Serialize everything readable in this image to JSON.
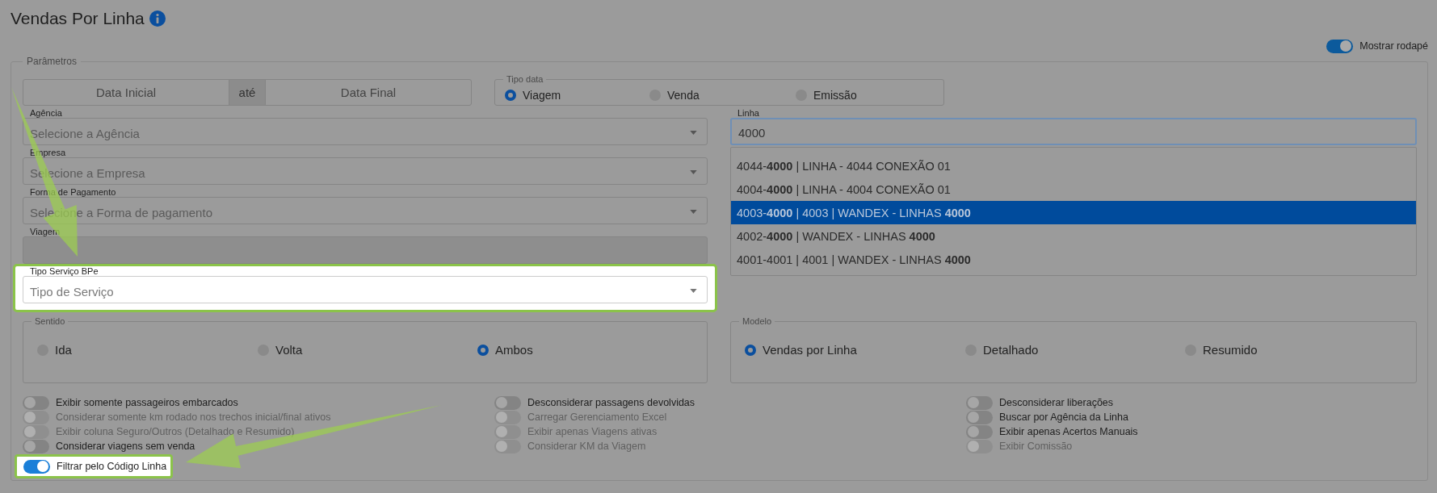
{
  "page": {
    "title": "Vendas Por Linha"
  },
  "footer_toggle": {
    "label": "Mostrar rodapé",
    "on": true
  },
  "parameters": {
    "legend": "Parâmetros",
    "date_range": {
      "start": "Data Inicial",
      "separator": "até",
      "end": "Data Final"
    },
    "date_type": {
      "legend": "Tipo data",
      "options": [
        {
          "label": "Viagem",
          "selected": true
        },
        {
          "label": "Venda",
          "selected": false
        },
        {
          "label": "Emissão",
          "selected": false
        }
      ]
    },
    "fields": [
      {
        "kind": "select",
        "label": "Agência",
        "placeholder": "Selecione a Agência",
        "disabled": false,
        "highlighted": false
      },
      {
        "kind": "select",
        "label": "Empresa",
        "placeholder": "Selecione a Empresa",
        "disabled": false,
        "highlighted": false
      },
      {
        "kind": "select",
        "label": "Forma de Pagamento",
        "placeholder": "Selecione a Forma de pagamento",
        "disabled": false,
        "highlighted": false
      },
      {
        "kind": "input",
        "label": "Viagem",
        "disabled": true,
        "highlighted": false
      },
      {
        "kind": "select",
        "label": "Tipo Serviço BPe",
        "placeholder": "Tipo de Serviço",
        "disabled": false,
        "highlighted": true
      }
    ],
    "linha": {
      "label": "Linha",
      "value": "4000",
      "suggestions": [
        {
          "text": "4044-**4000** | LINHA - 4044 CONEXÃO 01",
          "selected": false
        },
        {
          "text": "4004-**4000** | LINHA - 4004 CONEXÃO 01",
          "selected": false
        },
        {
          "text": "4003-**4000** | 4003 | WANDEX - LINHAS **4000**",
          "selected": true
        },
        {
          "text": "4002-**4000** | WANDEX - LINHAS **4000**",
          "selected": false
        },
        {
          "text": "4001-4001 | 4001 | WANDEX - LINHAS **4000**",
          "selected": false
        }
      ]
    },
    "direction": {
      "legend": "Sentido",
      "options": [
        {
          "label": "Ida",
          "selected": false
        },
        {
          "label": "Volta",
          "selected": false
        },
        {
          "label": "Ambos",
          "selected": true
        }
      ]
    },
    "model": {
      "legend": "Modelo",
      "options": [
        {
          "label": "Vendas por Linha",
          "selected": true
        },
        {
          "label": "Detalhado",
          "selected": false
        },
        {
          "label": "Resumido",
          "selected": false
        }
      ]
    },
    "option_columns": [
      {
        "items": [
          {
            "label": "Exibir somente passageiros embarcados",
            "on": false,
            "disabled": false,
            "highlighted": false
          },
          {
            "label": "Considerar somente km rodado nos trechos inicial/final ativos",
            "on": false,
            "disabled": true,
            "highlighted": false
          },
          {
            "label": "Exibir coluna Seguro/Outros (Detalhado e Resumido)",
            "on": false,
            "disabled": true,
            "highlighted": false
          },
          {
            "label": "Considerar viagens sem venda",
            "on": false,
            "disabled": false,
            "highlighted": false
          },
          {
            "label": "Filtrar pelo Código Linha",
            "on": true,
            "disabled": false,
            "highlighted": true
          }
        ]
      },
      {
        "items": [
          {
            "label": "Desconsiderar passagens devolvidas",
            "on": false,
            "disabled": false,
            "highlighted": false
          },
          {
            "label": "Carregar Gerenciamento Excel",
            "on": false,
            "disabled": true,
            "highlighted": false
          },
          {
            "label": "Exibir apenas Viagens ativas",
            "on": false,
            "disabled": true,
            "highlighted": false
          },
          {
            "label": "Considerar KM da Viagem",
            "on": false,
            "disabled": true,
            "highlighted": false
          }
        ]
      },
      {
        "items": [
          {
            "label": "Desconsiderar liberações",
            "on": false,
            "disabled": false,
            "highlighted": false
          },
          {
            "label": "Buscar por Agência da Linha",
            "on": false,
            "disabled": false,
            "highlighted": false
          },
          {
            "label": "Exibir apenas Acertos Manuais",
            "on": false,
            "disabled": false,
            "highlighted": false
          },
          {
            "label": "Exibir Comissão",
            "on": false,
            "disabled": true,
            "highlighted": false
          }
        ]
      }
    ]
  }
}
